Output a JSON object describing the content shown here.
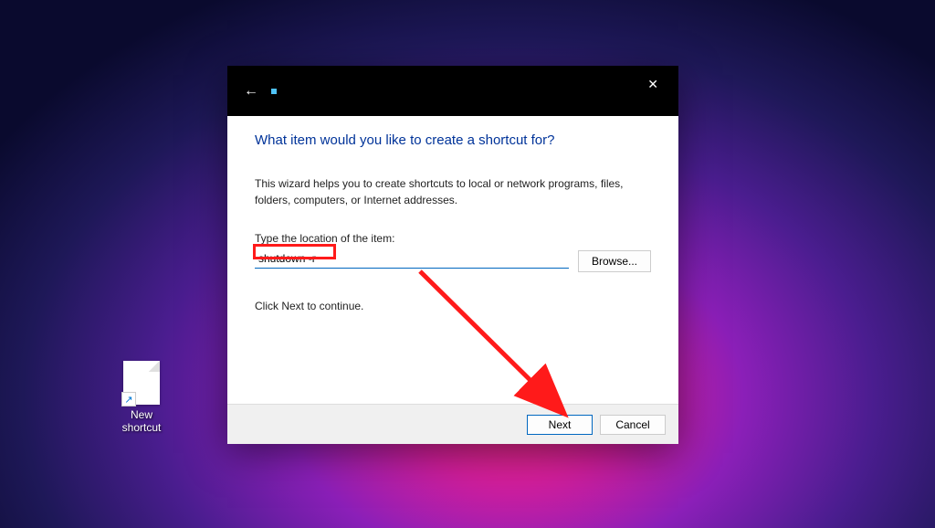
{
  "desktop": {
    "icon_label": "New shortcut"
  },
  "dialog": {
    "heading": "What item would you like to create a shortcut for?",
    "description": "This wizard helps you to create shortcuts to local or network programs, files, folders, computers, or Internet addresses.",
    "location_label": "Type the location of the item:",
    "location_value": "shutdown -r",
    "browse_label": "Browse...",
    "continue_text": "Click Next to continue.",
    "next_label": "Next",
    "cancel_label": "Cancel"
  },
  "annotations": {
    "highlight_color": "#ff1a1a",
    "arrow_color": "#ff1a1a"
  }
}
